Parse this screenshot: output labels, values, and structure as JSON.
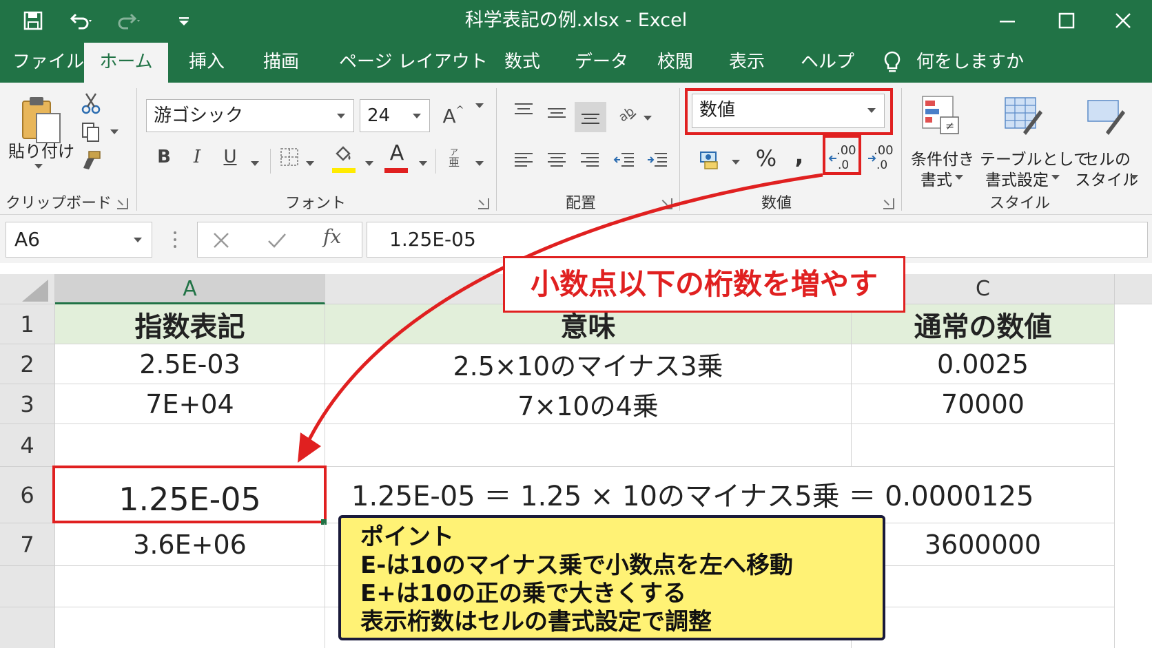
{
  "window": {
    "title": "科学表記の例.xlsx  -  Excel"
  },
  "tabs": [
    {
      "label": "ファイル",
      "active": false
    },
    {
      "label": "ホーム",
      "active": true
    },
    {
      "label": "挿入",
      "active": false
    },
    {
      "label": "描画",
      "active": false
    },
    {
      "label": "ページ レイアウト",
      "active": false
    },
    {
      "label": "数式",
      "active": false
    },
    {
      "label": "データ",
      "active": false
    },
    {
      "label": "校閲",
      "active": false
    },
    {
      "label": "表示",
      "active": false
    },
    {
      "label": "ヘルプ",
      "active": false
    }
  ],
  "tell_me": {
    "placeholder": "何をしますか"
  },
  "ribbon": {
    "clipboard": {
      "paste_label": "貼り付け",
      "group_label": "クリップボード"
    },
    "font": {
      "font_name": "游ゴシック",
      "font_size": "24",
      "bold": "B",
      "italic": "I",
      "underline": "U",
      "grow": "A",
      "font_color_letter": "A",
      "group_label": "フォント",
      "fill_color": "#ffeb00",
      "font_color": "#e02020"
    },
    "alignment": {
      "group_label": "配置"
    },
    "number": {
      "format_value": "数値",
      "percent": "%",
      "comma": ",",
      "increase_decimal": ".00",
      "decrease_decimal": ".00",
      "group_label": "数値"
    },
    "styles": {
      "conditional_line1": "条件付き",
      "conditional_line2": "書式",
      "table_line1": "テーブルとして",
      "table_line2": "書式設定",
      "cell_line1": "セルの",
      "cell_line2": "スタイル",
      "group_label": "スタイル"
    }
  },
  "formula_bar": {
    "name_box": "A6",
    "fx": "fx",
    "formula": "1.25E-05"
  },
  "columns": [
    {
      "label": "A",
      "selected": true
    },
    {
      "label": "",
      "selected": false
    },
    {
      "label": "C",
      "selected": false
    }
  ],
  "rows": [
    {
      "label": "1",
      "cells": [
        "指数表記",
        "意味",
        "通常の数値"
      ]
    },
    {
      "label": "2",
      "cells": [
        "2.5E-03",
        "2.5×10のマイナス3乗",
        "0.0025"
      ]
    },
    {
      "label": "3",
      "cells": [
        "7E+04",
        "7×10の4乗",
        "70000"
      ]
    },
    {
      "label": "4",
      "cells": [
        "",
        "",
        ""
      ]
    },
    {
      "label": "6",
      "cells": [
        "1.25E-05",
        "",
        ""
      ]
    },
    {
      "label": "7",
      "cells": [
        "3.6E+06",
        "",
        "3600000"
      ]
    }
  ],
  "row6_explanation": "1.25E-05 ＝ 1.25 × 10のマイナス5乗 ＝ 0.0000125",
  "annotations": {
    "callout": "小数点以下の桁数を増やす",
    "point": {
      "title": "ポイント",
      "lines": [
        "E-は10のマイナス乗で小数点を左へ移動",
        "E+は10の正の乗で大きくする",
        "表示桁数はセルの書式設定で調整"
      ]
    }
  },
  "colors": {
    "excel_green": "#217346",
    "highlight_red": "#e02020",
    "header_fill": "#e2efda",
    "point_fill": "#fff275"
  }
}
